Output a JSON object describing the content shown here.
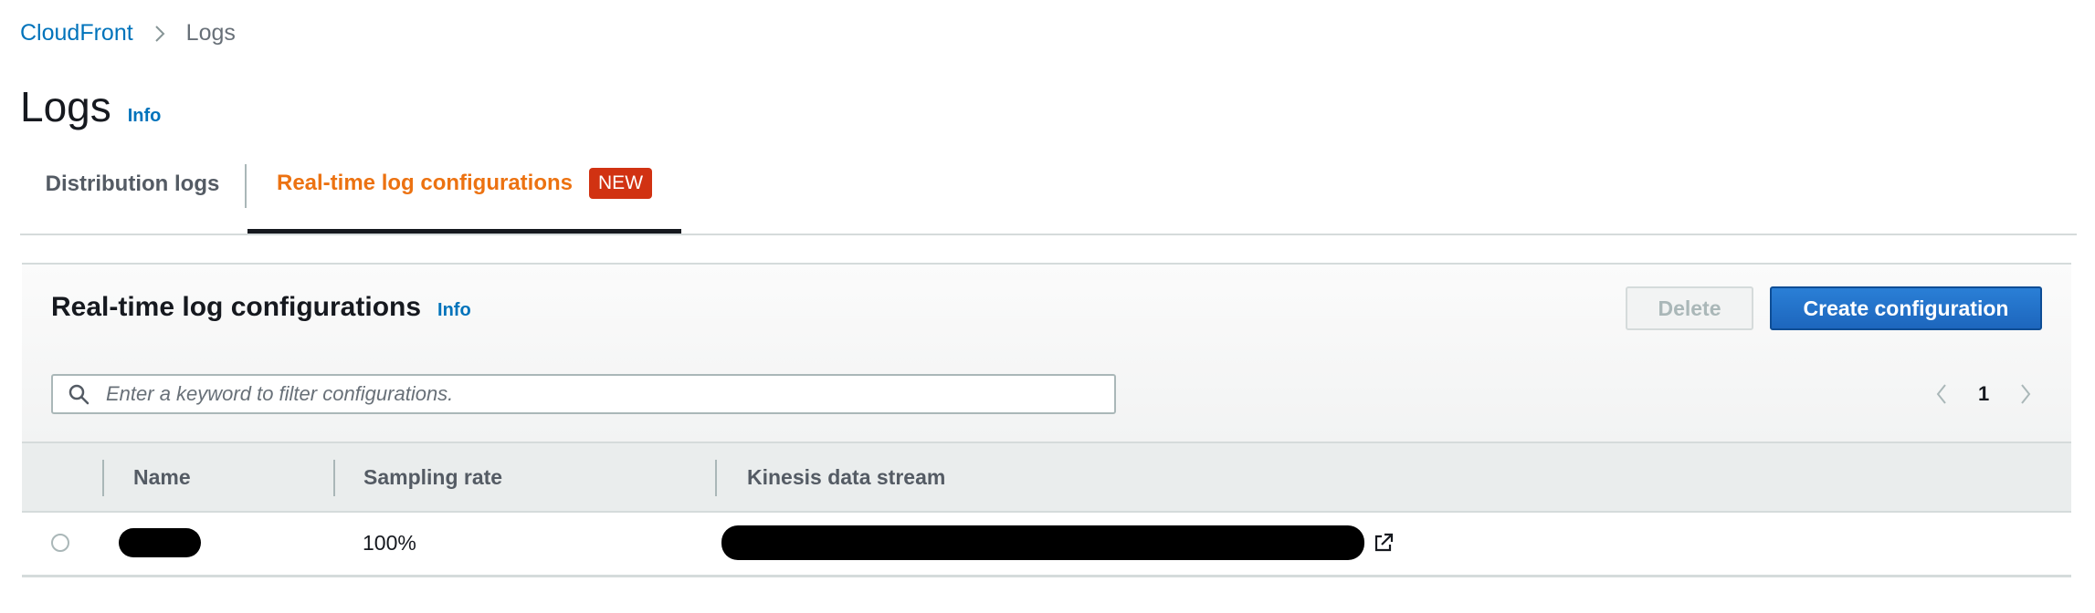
{
  "breadcrumb": {
    "root": "CloudFront",
    "current": "Logs"
  },
  "page": {
    "title": "Logs",
    "info": "Info"
  },
  "tabs": [
    {
      "label": "Distribution logs",
      "active": false
    },
    {
      "label": "Real-time log configurations",
      "active": true,
      "badge": "NEW"
    }
  ],
  "panel": {
    "title": "Real-time log configurations",
    "info": "Info",
    "delete_label": "Delete",
    "create_label": "Create configuration",
    "search_placeholder": "Enter a keyword to filter configurations.",
    "current_page": "1"
  },
  "table": {
    "columns": [
      "Name",
      "Sampling rate",
      "Kinesis data stream"
    ],
    "rows": [
      {
        "name": "",
        "sampling_rate": "100%",
        "kinesis_data_stream": ""
      }
    ]
  },
  "colors": {
    "link": "#0073bb",
    "active_tab": "#ec7211",
    "badge": "#d13212",
    "primary_button": "#1f6fc8"
  },
  "icons": {
    "breadcrumb_separator": "chevron-right-icon",
    "search": "search-icon",
    "prev": "chevron-left-icon",
    "next": "chevron-right-icon",
    "external_link": "external-link-icon"
  }
}
